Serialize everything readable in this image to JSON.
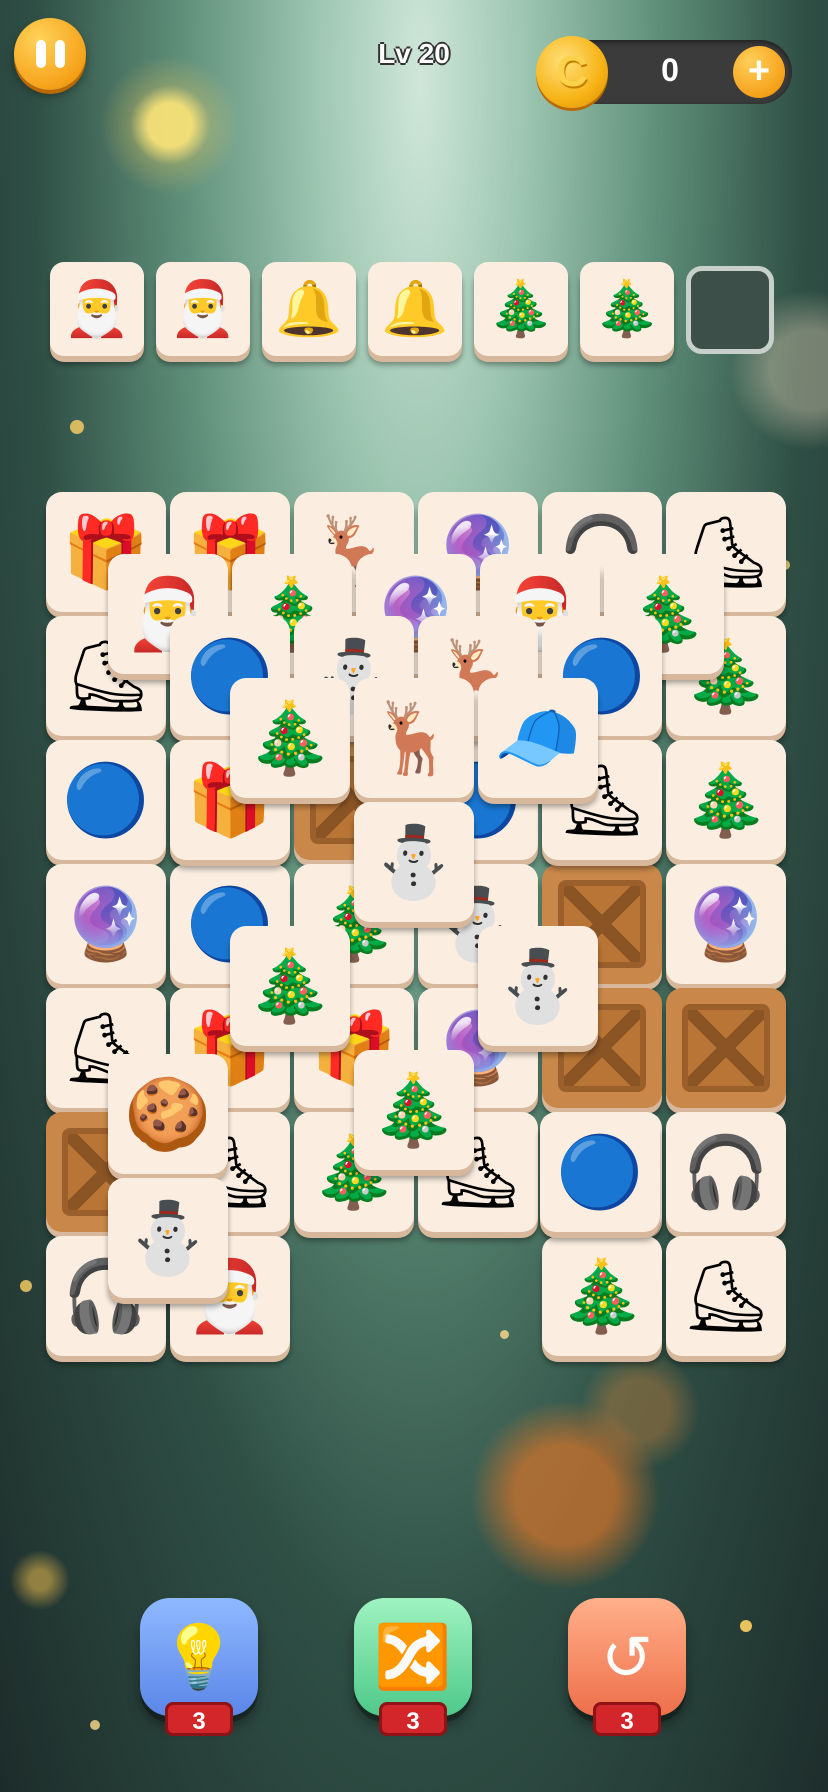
{
  "header": {
    "level_label": "Lv 20",
    "coins": "0",
    "plus_label": "+",
    "coin_symbol": "C"
  },
  "icons": {
    "boot": "🎅",
    "bell": "🔔",
    "wreath": "🎄",
    "snowglobe": "🔮",
    "reindeer": "🦌",
    "hat": "🧢",
    "snowman": "⛄",
    "gift": "🎁",
    "skate": "⛸",
    "ornament": "🔵",
    "gingerbread": "🍪",
    "tree": "🎄",
    "earmuff": "🎧"
  },
  "tray": {
    "slots": [
      "boot",
      "boot",
      "bell",
      "bell",
      "wreath",
      "wreath",
      ""
    ]
  },
  "board": {
    "layer1": [
      "gift",
      "gift",
      "reindeer",
      "snowglobe",
      "earmuff",
      "skate",
      "skate",
      "ornament",
      "ornament",
      "ornament",
      "ornament",
      "tree",
      "ornament",
      "crate",
      "crate",
      "ornament",
      "gingerbread",
      "wreath",
      "snowglobe",
      "ornament",
      "tree",
      "snowman",
      "crate",
      "snowglobe",
      "skate",
      "gift",
      "gift",
      "snowglobe",
      "crate",
      "crate",
      "crate",
      "skate",
      "tree",
      "skate",
      "ornament",
      "earmuff",
      "earmuff",
      "boot",
      "",
      "",
      "tree",
      "skate"
    ],
    "layer2": [
      "boot",
      "wreath",
      "snowglobe",
      "boot",
      "wreath",
      "ornament",
      "snowman",
      "reindeer",
      "ornament",
      "skate",
      "gift",
      "gingerbread",
      "snowman"
    ],
    "layer3": [
      "wreath",
      "reindeer",
      "hat",
      "snowman",
      "wreath",
      "snowman",
      "wreath",
      "ornament"
    ]
  },
  "boosters": [
    {
      "name": "hint",
      "icon": "💡",
      "count": "3"
    },
    {
      "name": "shuffle",
      "icon": "🔀",
      "count": "3"
    },
    {
      "name": "undo",
      "icon": "↺",
      "count": "3"
    }
  ]
}
